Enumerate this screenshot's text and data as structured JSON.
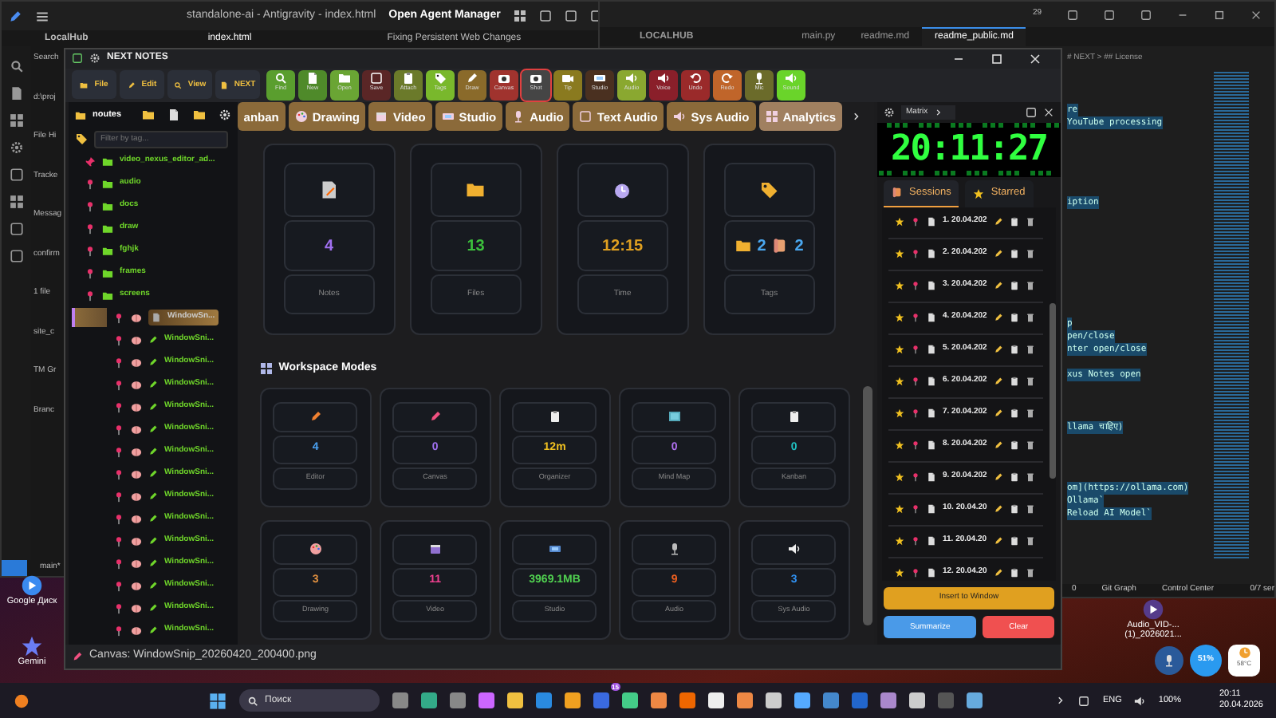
{
  "editor_window": {
    "title": "standalone-ai - Antigravity - index.html",
    "agent_manager": "Open Agent Manager",
    "explorer_title": "LocalHub",
    "tab": "index.html",
    "chat_title": "Fixing Persistent Web Changes",
    "panel_fragments": [
      "Search",
      "d:\\proj",
      "File Hi",
      "Tracke",
      "Messag",
      "confirm",
      "1 file",
      "site_c",
      "TM Gr",
      "Branc"
    ],
    "branch": "main*"
  },
  "code_window": {
    "badge": "29",
    "explorer_title": "LOCALHUB",
    "tabs": [
      {
        "label": "main.py",
        "selected": false
      },
      {
        "label": "readme.md",
        "selected": false
      },
      {
        "label": "readme_public.md",
        "selected": true
      }
    ],
    "breadcrumb": "# NEXT > ## License",
    "code_blocks": [
      [
        "re",
        "YouTube processing"
      ],
      [
        "iption"
      ],
      [
        "p",
        "pen/close",
        "nter open/close"
      ],
      [
        "xus Notes open"
      ],
      [
        "llama चाहिए)"
      ],
      [
        "om](https://ollama.com)",
        "Ollama`",
        "Reload AI Model`"
      ]
    ],
    "status": [
      "0",
      "Git Graph",
      "Control Center",
      "0/7 ser"
    ]
  },
  "desktop_icons": [
    {
      "label": "Google Диск"
    },
    {
      "label": "Gemini"
    },
    {
      "label": "Audio_VID-... (1)_2026021..."
    }
  ],
  "next_notes": {
    "title": "NEXT NOTES",
    "menus": [
      "File",
      "Edit",
      "View",
      "NEXT"
    ],
    "tools": [
      {
        "label": "Find",
        "color": "#5a9e2e",
        "selected": false
      },
      {
        "label": "New",
        "color": "#4f8a2a",
        "selected": false
      },
      {
        "label": "Open",
        "color": "#6aa534",
        "selected": false
      },
      {
        "label": "Save",
        "color": "#5a2626",
        "selected": false
      },
      {
        "label": "Attach",
        "color": "#6b7a2a",
        "selected": false
      },
      {
        "label": "Tags",
        "color": "#79b82c",
        "selected": false
      },
      {
        "label": "Draw",
        "color": "#8a6a2a",
        "selected": false
      },
      {
        "label": "Canvas",
        "color": "#a0332e",
        "selected": false
      },
      {
        "label": "Shot",
        "color": "#454545",
        "selected": true
      },
      {
        "label": "Tip",
        "color": "#8a7a1f",
        "selected": false
      },
      {
        "label": "Studio",
        "color": "#4a3020",
        "selected": false
      },
      {
        "label": "Audio",
        "color": "#8aa830",
        "selected": false
      },
      {
        "label": "Voice",
        "color": "#8a1f2a",
        "selected": false
      },
      {
        "label": "Undo",
        "color": "#9a2a2a",
        "selected": false
      },
      {
        "label": "Redo",
        "color": "#c0652a",
        "selected": false
      },
      {
        "label": "Mic",
        "color": "#6b6b2a",
        "selected": false
      },
      {
        "label": "Sound",
        "color": "#6ad42a",
        "selected": false
      }
    ],
    "mode_tabs": [
      {
        "label": "anban",
        "selected": false
      },
      {
        "label": "Drawing",
        "selected": false
      },
      {
        "label": "Video",
        "selected": false
      },
      {
        "label": "Studio",
        "selected": false
      },
      {
        "label": "Audio",
        "selected": false
      },
      {
        "label": "Text Audio",
        "selected": false
      },
      {
        "label": "Sys Audio",
        "selected": false
      },
      {
        "label": "Analytics",
        "selected": true
      }
    ],
    "sidebar": {
      "folder": "noutes",
      "filter_placeholder": "Filter by tag...",
      "tree": [
        {
          "label": "video_nexus_editor_ad...",
          "pinned": true
        },
        {
          "label": "audio",
          "pinned": false
        },
        {
          "label": "docs",
          "pinned": false
        },
        {
          "label": "draw",
          "pinned": false
        },
        {
          "label": "fghjk",
          "pinned": false
        },
        {
          "label": "frames",
          "pinned": false
        },
        {
          "label": "screens",
          "pinned": false,
          "children": [
            {
              "label": "WindowSn...",
              "selected": true
            },
            {
              "label": "WindowSni...",
              "selected": false
            },
            {
              "label": "WindowSni...",
              "selected": false
            },
            {
              "label": "WindowSni...",
              "selected": false
            },
            {
              "label": "WindowSni...",
              "selected": false
            },
            {
              "label": "WindowSni...",
              "selected": false
            },
            {
              "label": "WindowSni...",
              "selected": false
            },
            {
              "label": "WindowSni...",
              "selected": false
            },
            {
              "label": "WindowSni...",
              "selected": false
            },
            {
              "label": "WindowSni...",
              "selected": false
            },
            {
              "label": "WindowSni...",
              "selected": false
            },
            {
              "label": "WindowSni...",
              "selected": false
            },
            {
              "label": "WindowSni...",
              "selected": false
            },
            {
              "label": "WindowSni...",
              "selected": false
            },
            {
              "label": "WindowSni...",
              "selected": false
            }
          ]
        }
      ]
    },
    "stats": [
      {
        "kind": "single",
        "value": "4",
        "label": "Notes",
        "color": "#a070f0"
      },
      {
        "kind": "single",
        "value": "13",
        "label": "Files",
        "color": "#3cc03c"
      },
      {
        "kind": "single",
        "value": "12:15",
        "label": "Time",
        "color": "#e0a020"
      },
      {
        "kind": "tags",
        "folders": "2",
        "scrolls": "2",
        "label": "Tags",
        "color": "#4aa8f0"
      }
    ],
    "modes_title": "Workspace Modes",
    "modes": [
      {
        "value": "4",
        "label": "Editor",
        "color": "#4aa0f0"
      },
      {
        "value": "0",
        "label": "Canvas",
        "color": "#a070f0"
      },
      {
        "value": "12m",
        "label": "Organizer",
        "color": "#f0c020"
      },
      {
        "value": "0",
        "label": "Mind Map",
        "color": "#b070f0"
      },
      {
        "value": "0",
        "label": "Kanban",
        "color": "#20c0c0"
      },
      {
        "value": "3",
        "label": "Drawing",
        "color": "#e09040"
      },
      {
        "value": "11",
        "label": "Video",
        "color": "#f04090"
      },
      {
        "value": "3969.1MB",
        "label": "Studio",
        "color": "#50d050"
      },
      {
        "value": "9",
        "label": "Audio",
        "color": "#f06020"
      },
      {
        "value": "3",
        "label": "Sys Audio",
        "color": "#3090f0"
      }
    ],
    "clock_panel": {
      "theme": "Matrix",
      "time": "20:11:27",
      "tabs": [
        {
          "label": "Sessions",
          "selected": true
        },
        {
          "label": "Starred",
          "selected": false
        }
      ],
      "sessions": [
        "1. 20.04.202",
        "2. 20.04.202",
        "3. 20.04.202",
        "4. 20.04.202",
        "5. 20.04.202",
        "6. 20.04.202",
        "7. 20.04.202",
        "8. 20.04.202",
        "9. 20.04.202",
        "10. 20.04.20",
        "11. 20.04.20",
        "12. 20.04.20"
      ],
      "insert_button": "Insert to Window",
      "summarize_button": "Summarize",
      "clear_button": "Clear"
    },
    "status": "Canvas: WindowSnip_20260420_200400.png"
  },
  "widgets": {
    "cpu": "51%",
    "temperature": "58°C"
  },
  "taskbar": {
    "search_placeholder": "Поиск",
    "app_badge": "15",
    "language": "ENG",
    "battery": "100%",
    "time": "20:11",
    "date": "20.04.2026"
  }
}
